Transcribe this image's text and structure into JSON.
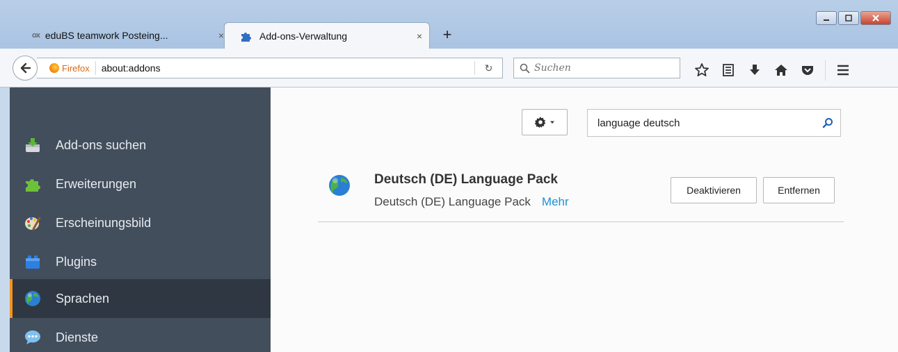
{
  "tabs": [
    {
      "icon": "ox",
      "title": "eduBS teamwork Posteing...",
      "close": "×",
      "active": false
    },
    {
      "icon": "puzzle-icon",
      "title": "Add-ons-Verwaltung",
      "close": "×",
      "active": true
    }
  ],
  "new_tab": "+",
  "nav": {
    "identity_label": "Firefox",
    "url": "about:addons",
    "reload": "↻",
    "search_placeholder": "Suchen"
  },
  "sidebar": {
    "categories": [
      {
        "label": "Add-ons suchen",
        "icon": "download-add-ons-icon",
        "selected": false
      },
      {
        "label": "Erweiterungen",
        "icon": "puzzle-icon",
        "selected": false
      },
      {
        "label": "Erscheinungsbild",
        "icon": "paintbrush-icon",
        "selected": false
      },
      {
        "label": "Plugins",
        "icon": "plugin-block-icon",
        "selected": false
      },
      {
        "label": "Sprachen",
        "icon": "globe-icon",
        "selected": true
      },
      {
        "label": "Dienste",
        "icon": "chat-bubble-icon",
        "selected": false
      }
    ]
  },
  "main": {
    "search_value": "language deutsch",
    "addon": {
      "name": "Deutsch (DE) Language Pack",
      "description": "Deutsch (DE) Language Pack",
      "more_link": "Mehr",
      "disable_label": "Deaktivieren",
      "remove_label": "Entfernen"
    }
  },
  "colors": {
    "sidebar_bg": "#434e5c",
    "sidebar_selected": "#2f3842",
    "accent_orange": "#f3941e",
    "link_blue": "#1e91d6"
  }
}
